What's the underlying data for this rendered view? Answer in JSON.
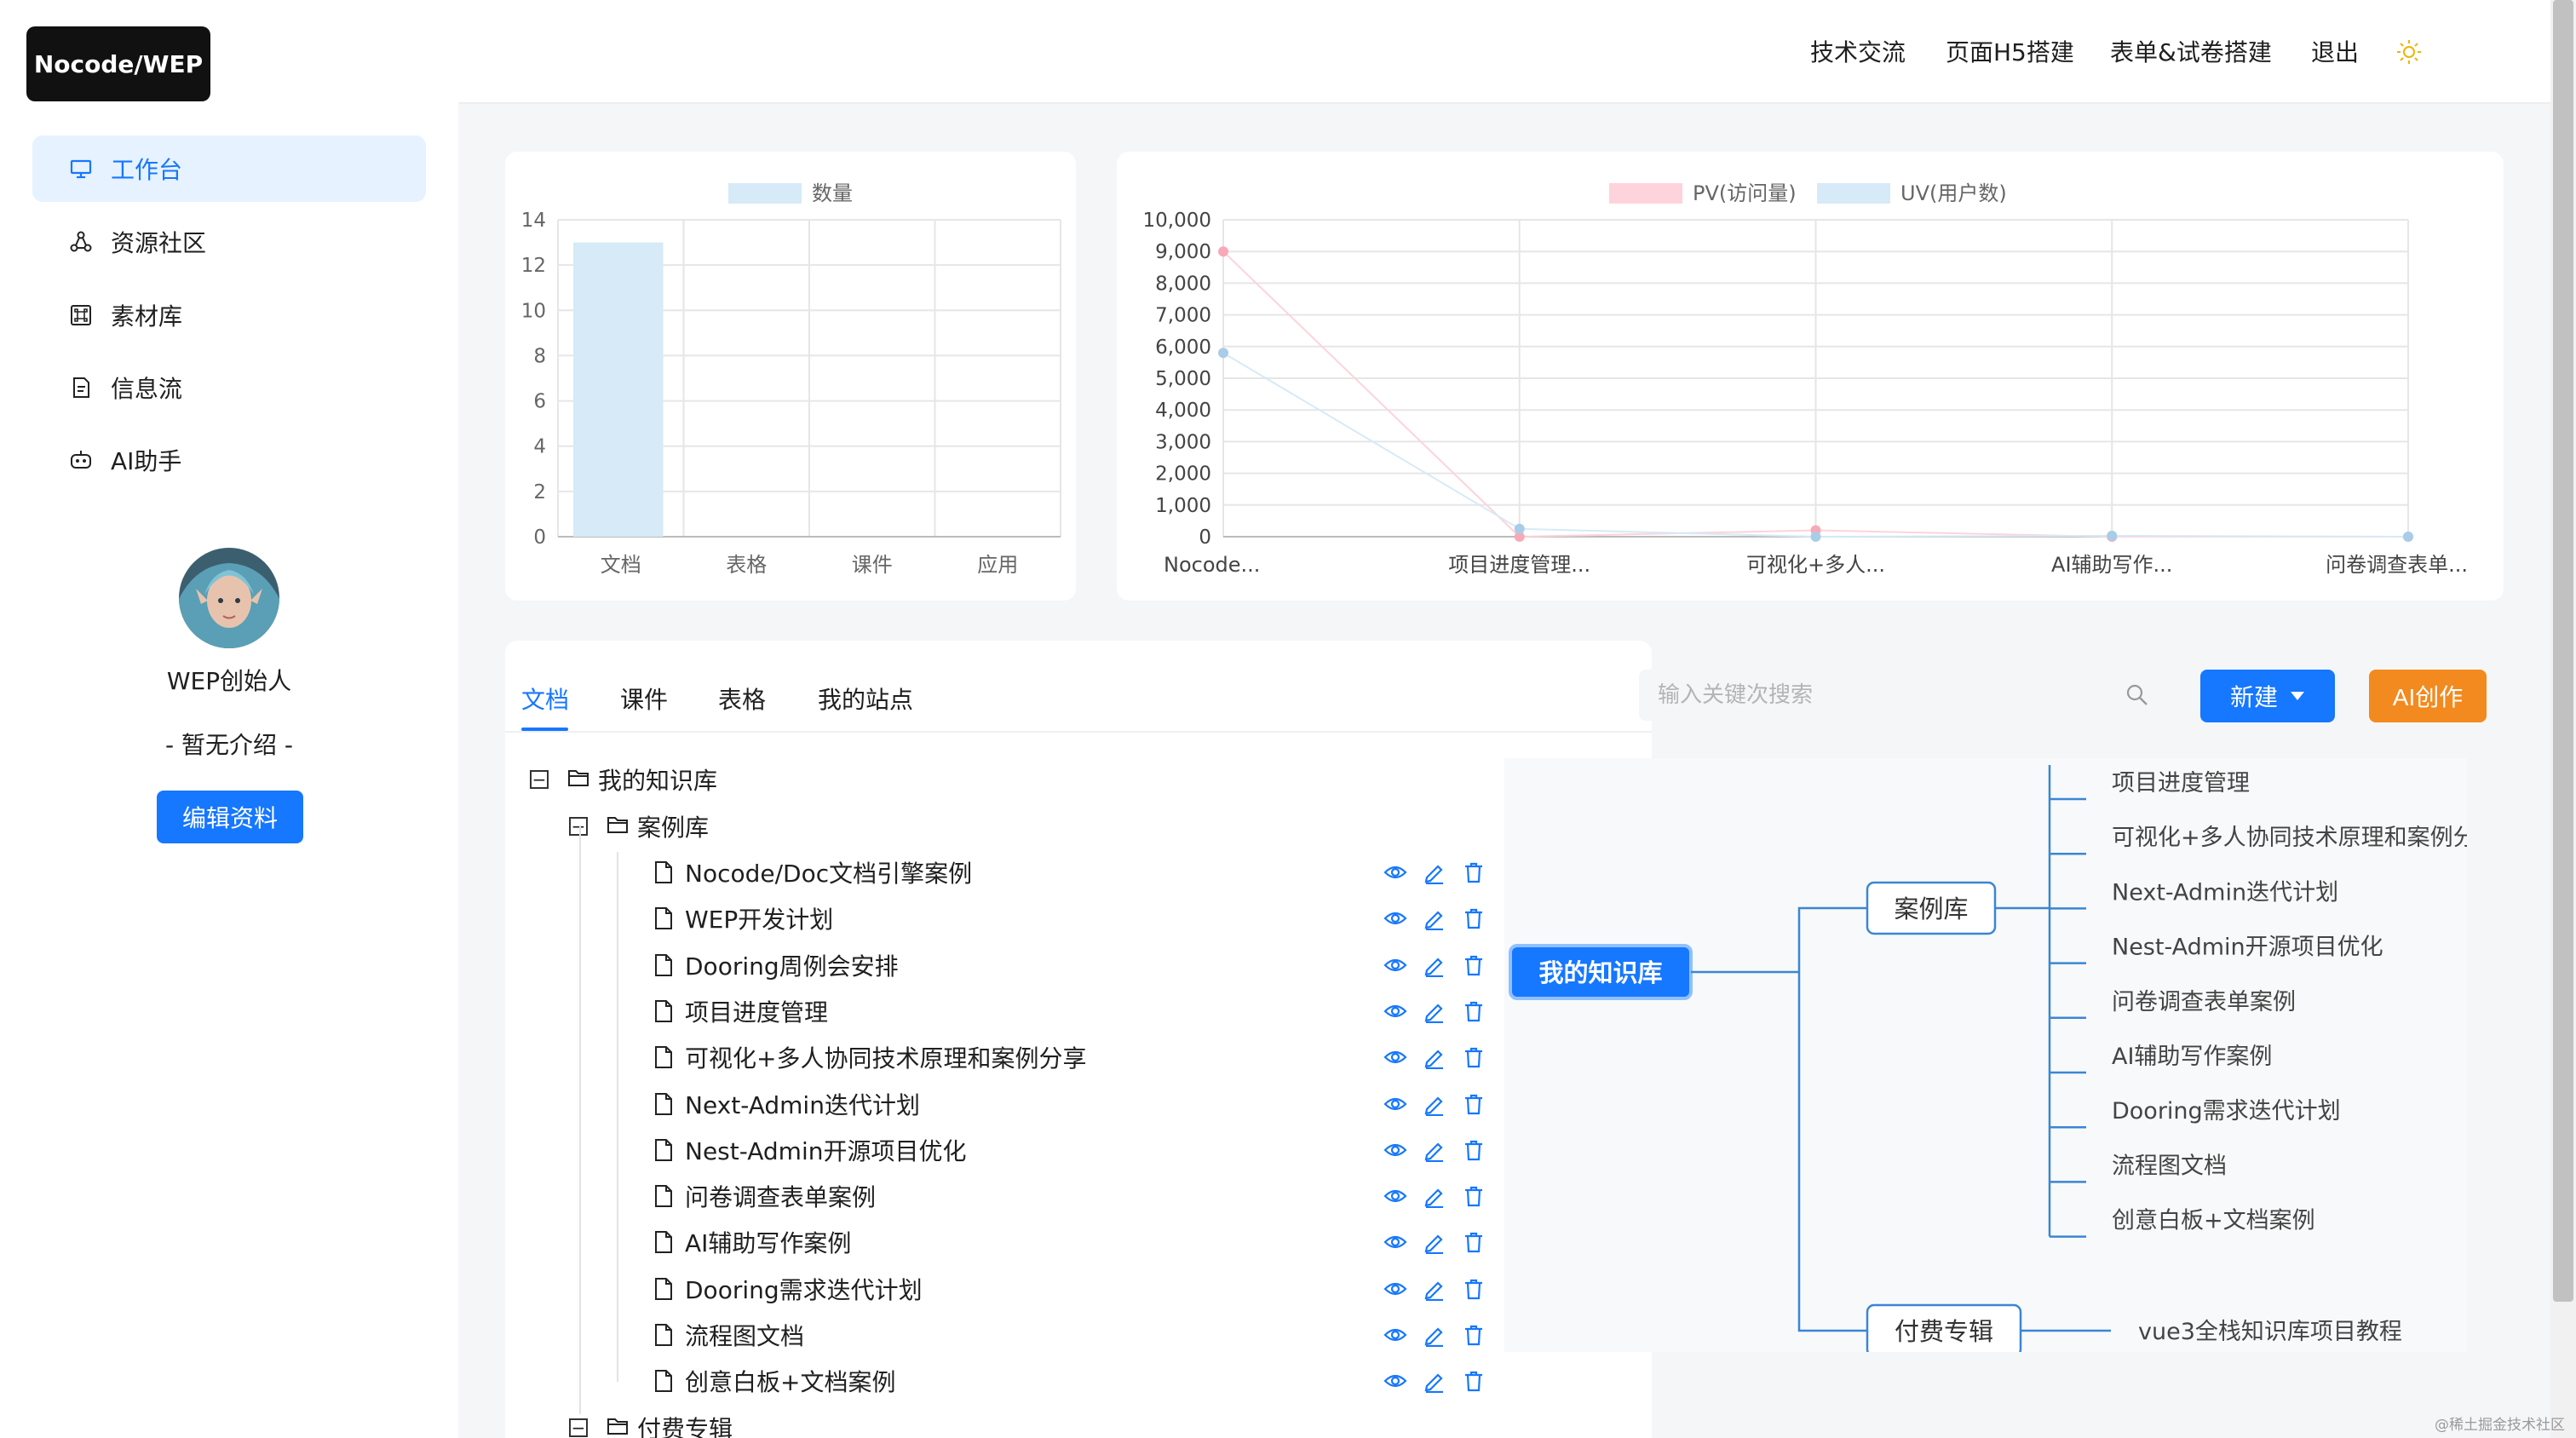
{
  "app": {
    "logo": "Nocode/WEP"
  },
  "topnav": {
    "items": [
      "技术交流",
      "页面H5搭建",
      "表单&试卷搭建",
      "退出"
    ],
    "theme_icon": "sun-icon"
  },
  "sidebar": {
    "items": [
      {
        "label": "工作台",
        "icon": "monitor-icon",
        "active": true
      },
      {
        "label": "资源社区",
        "icon": "share-nodes-icon"
      },
      {
        "label": "素材库",
        "icon": "command-icon"
      },
      {
        "label": "信息流",
        "icon": "file-icon"
      },
      {
        "label": "AI助手",
        "icon": "robot-icon"
      }
    ],
    "profile": {
      "name": "WEP创始人",
      "intro": "- 暂无介绍 -",
      "edit_label": "编辑资料"
    }
  },
  "colors": {
    "primary": "#1677ff",
    "orange": "#f28a1f",
    "bar": "#d6eaf8",
    "pv": "#ffd3db",
    "uv": "#d6eaf8"
  },
  "chart_data": [
    {
      "type": "bar",
      "legend": [
        "数量"
      ],
      "categories": [
        "文档",
        "表格",
        "课件",
        "应用"
      ],
      "series": [
        {
          "name": "数量",
          "values": [
            13,
            0,
            0,
            0
          ]
        }
      ],
      "ylim": [
        0,
        14
      ],
      "yticks": [
        0,
        2,
        4,
        6,
        8,
        10,
        12,
        14
      ]
    },
    {
      "type": "line",
      "legend": [
        "PV(访问量)",
        "UV(用户数)"
      ],
      "categories": [
        "Nocode...",
        "项目进度管理...",
        "可视化+多人...",
        "AI辅助写作...",
        "问卷调查表单..."
      ],
      "series": [
        {
          "name": "PV(访问量)",
          "values": [
            9000,
            0,
            200,
            0,
            0
          ]
        },
        {
          "name": "UV(用户数)",
          "values": [
            5800,
            250,
            0,
            30,
            0
          ]
        }
      ],
      "ylim": [
        0,
        10000
      ],
      "yticks": [
        "0",
        "1,000",
        "2,000",
        "3,000",
        "4,000",
        "5,000",
        "6,000",
        "7,000",
        "8,000",
        "9,000",
        "10,000"
      ]
    }
  ],
  "tabs": [
    "文档",
    "课件",
    "表格",
    "我的站点"
  ],
  "search": {
    "placeholder": "输入关键次搜索"
  },
  "buttons": {
    "new_label": "新建",
    "ai_label": "AI创作"
  },
  "tree": {
    "root": "我的知识库",
    "folder1": "案例库",
    "folder1_items": [
      "Nocode/Doc文档引擎案例",
      "WEP开发计划",
      "Dooring周例会安排",
      "项目进度管理",
      "可视化+多人协同技术原理和案例分享",
      "Next-Admin迭代计划",
      "Nest-Admin开源项目优化",
      "问卷调查表单案例",
      "AI辅助写作案例",
      "Dooring需求迭代计划",
      "流程图文档",
      "创意白板+文档案例"
    ],
    "folder2": "付费专辑"
  },
  "mindmap": {
    "root": "我的知识库",
    "branch1": "案例库",
    "branch1_children": [
      "项目进度管理",
      "可视化+多人协同技术原理和案例分享",
      "Next-Admin迭代计划",
      "Nest-Admin开源项目优化",
      "问卷调查表单案例",
      "AI辅助写作案例",
      "Dooring需求迭代计划",
      "流程图文档",
      "创意白板+文档案例"
    ],
    "branch2": "付费专辑",
    "branch2_children": [
      "vue3全栈知识库项目教程"
    ]
  },
  "watermark": "@稀土掘金技术社区"
}
